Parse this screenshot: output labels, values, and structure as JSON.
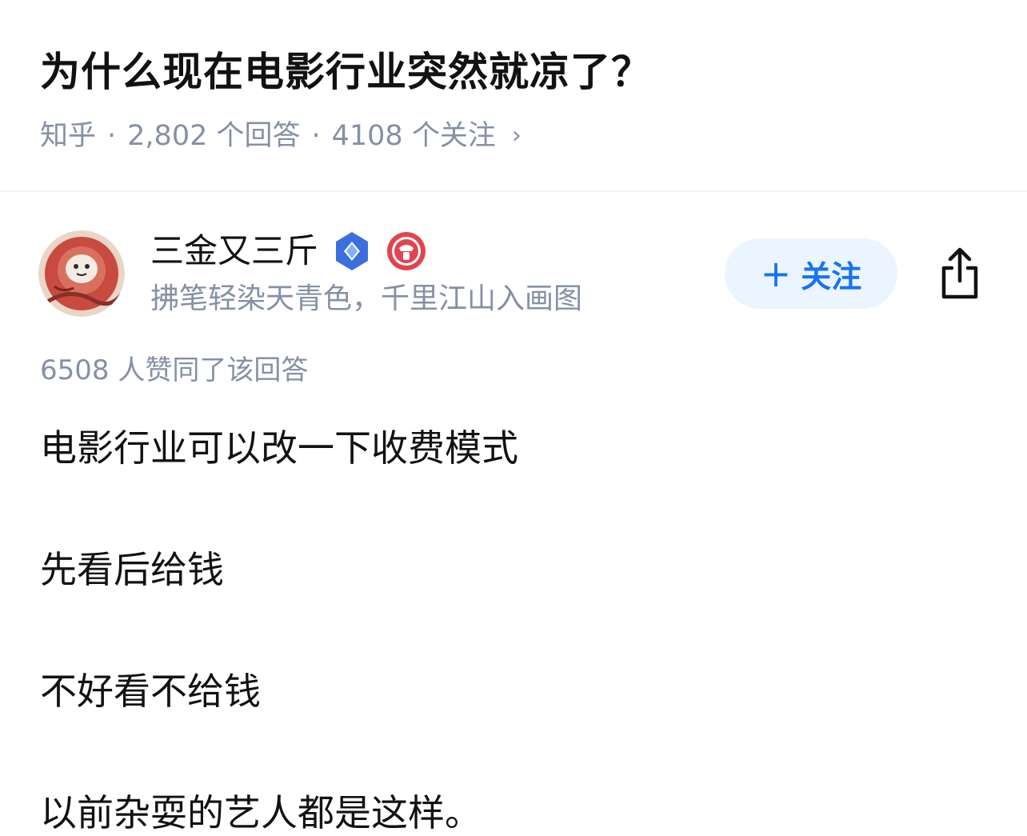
{
  "question": {
    "title": "为什么现在电影行业突然就凉了？",
    "source": "知乎",
    "answers": "2,802 个回答",
    "followers": "4108 个关注",
    "separator": "·",
    "chevron": "›"
  },
  "author": {
    "name": "三金又三斤",
    "bio": "拂笔轻染天青色，千里江山入画图",
    "avatar_icon": "avatar-illustration",
    "badges": [
      "verified-diamond-icon",
      "red-circle-badge-icon"
    ]
  },
  "actions": {
    "follow_plus": "+",
    "follow_label": "关注",
    "share_icon": "share-icon"
  },
  "answer": {
    "upvotes": "6508 人赞同了该回答",
    "paragraphs": [
      "电影行业可以改一下收费模式",
      "先看后给钱",
      "不好看不给钱",
      "以前杂耍的艺人都是这样。"
    ]
  },
  "colors": {
    "accent": "#1772f6",
    "follow_bg": "#ebf5ff",
    "meta_gray": "#8590a6",
    "text": "#121212"
  }
}
